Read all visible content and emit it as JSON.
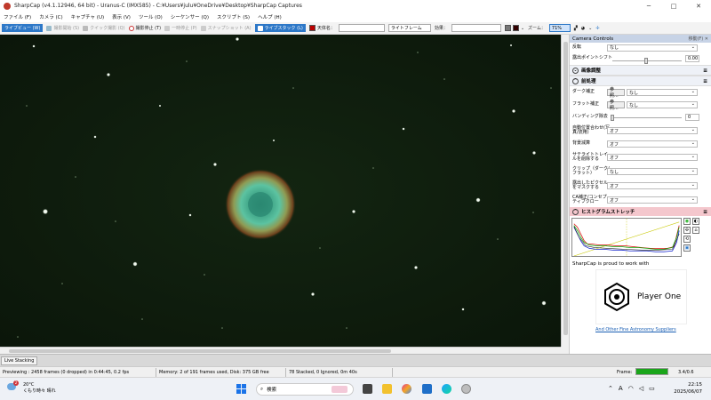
{
  "window": {
    "title": "SharpCap (v4.1.12946, 64 bit) - Uranus-C (IMX585) - C:¥Users¥julu¥OneDrive¥Desktop¥SharpCap Captures",
    "controls": [
      "─",
      "□",
      "✕"
    ]
  },
  "menu": [
    "ファイル (F)",
    "カメラ (C)",
    "キャプチャ (U)",
    "表示 (V)",
    "ツール (O)",
    "シーケンサー (Q)",
    "スクリプト (S)",
    "ヘルプ (H)"
  ],
  "toolbar": {
    "live_view": "ライブビュー (W)",
    "start_capture": "撮影開始 (S)",
    "quick_capture": "クイック撮影 (Q)",
    "stop_capture": "撮影停止 (T)",
    "pause": "一時停止 (P)",
    "snapshot": "スナップショット (A)",
    "live_stack": "ライブスタック (L)",
    "target_name_label": "天体名：",
    "target_name_value": "",
    "frame_type": "ライトフレーム",
    "effect_label": "効果：",
    "effect_value": "",
    "zoom_label": "ズーム：",
    "zoom_value": "71%"
  },
  "camera_panel": {
    "title": "Camera Controls",
    "float_label": "移動(F)",
    "flip_label": "反転",
    "flip_value": "なし",
    "black_point_label": "露出ポイントシフト",
    "black_point_value": "0.00",
    "image_adjust": "画像調整",
    "preprocess": "前処理",
    "dark_label": "ダーク補正",
    "dark_button": "参照...",
    "dark_value": "なし",
    "flat_label": "フラット補正",
    "flat_button": "参照...",
    "flat_value": "なし",
    "banding_label": "バンディング除去",
    "banding_value": "0",
    "auto_align_label": "自動位置合わせ(写真/流用)",
    "auto_align_value": "オフ",
    "bg_sub_label": "背景減算",
    "bg_sub_value": "オフ",
    "sat_label": "サテライトトレイルを削除する",
    "sat_value": "オフ",
    "clip_label": "クリップ（ダーク/フラット）",
    "clip_value": "なし",
    "hot_label": "露出したピクセルをマスクする",
    "hot_value": "オフ",
    "ca_label": "CA補正/コンセプティブクロー",
    "ca_value": "オフ",
    "histogram_title": "ヒストグラムストレッチ",
    "partner_msg": "SharpCap is proud to work with",
    "partner_name": "Player One",
    "partner_link": "And Other Fine Astronomy Suppliers"
  },
  "bottom_tab": "Live Stacking",
  "status": {
    "previewing": "Previewing : 2458 frames (0 dropped) in 0:44:45, 0.2 fps",
    "memory": "Memory: 2 of 191 frames used, Disk: 375 GB free",
    "stacked": "78 Stacked, 0 Ignored, 0m 40s",
    "frame_label": "Frame:",
    "frame_progress": 1.0,
    "frame_time": "3.4/0.6"
  },
  "taskbar": {
    "weather_badge": "2",
    "temp": "20°C",
    "weather_desc": "くもり時々 晴れ",
    "search_placeholder": "検索",
    "tray_lang": "A",
    "time": "22:15",
    "date": "2025/06/07"
  },
  "colors": {
    "accent": "#2d78c8",
    "image_bg": "#0e1a0a",
    "histogram_header": "#f4c7cd",
    "panel_header": "#c7d3e6",
    "frame_bar": "#1aa51a"
  }
}
